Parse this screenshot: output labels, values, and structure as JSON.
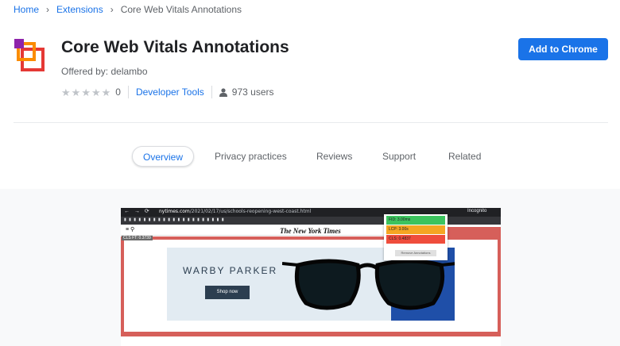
{
  "breadcrumb": {
    "home": "Home",
    "extensions": "Extensions",
    "current": "Core Web Vitals Annotations"
  },
  "extension": {
    "title": "Core Web Vitals Annotations",
    "offered_by": "Offered by: delambo",
    "rating_value": 0,
    "rating_count": "0",
    "category": "Developer Tools",
    "users": "973 users",
    "add_button": "Add to Chrome"
  },
  "tabs": [
    {
      "label": "Overview",
      "active": true
    },
    {
      "label": "Privacy practices",
      "active": false
    },
    {
      "label": "Reviews",
      "active": false
    },
    {
      "label": "Support",
      "active": false
    },
    {
      "label": "Related",
      "active": false
    }
  ],
  "screenshot": {
    "url_domain": "nytimes.com",
    "url_path": "/2021/02/17/us/schools-reopening-west-coast.html",
    "incognito": "Incognito",
    "site_logo": "The New York Times",
    "cls_tag": "CLS FT: 0.3739",
    "ad_brand": "WARBY PARKER",
    "ad_button": "Shop now",
    "metrics": [
      {
        "label": "FID: 3.00ms",
        "color": "#3cc35e"
      },
      {
        "label": "LCP: 3.00s",
        "color": "#f5a623"
      },
      {
        "label": "CLS: 0.4837",
        "color": "#ef4d3c"
      }
    ],
    "popup_button": "Remove Annotations"
  },
  "colors": {
    "accent": "#1a73e8",
    "annotation_red": "#d65f5a"
  }
}
